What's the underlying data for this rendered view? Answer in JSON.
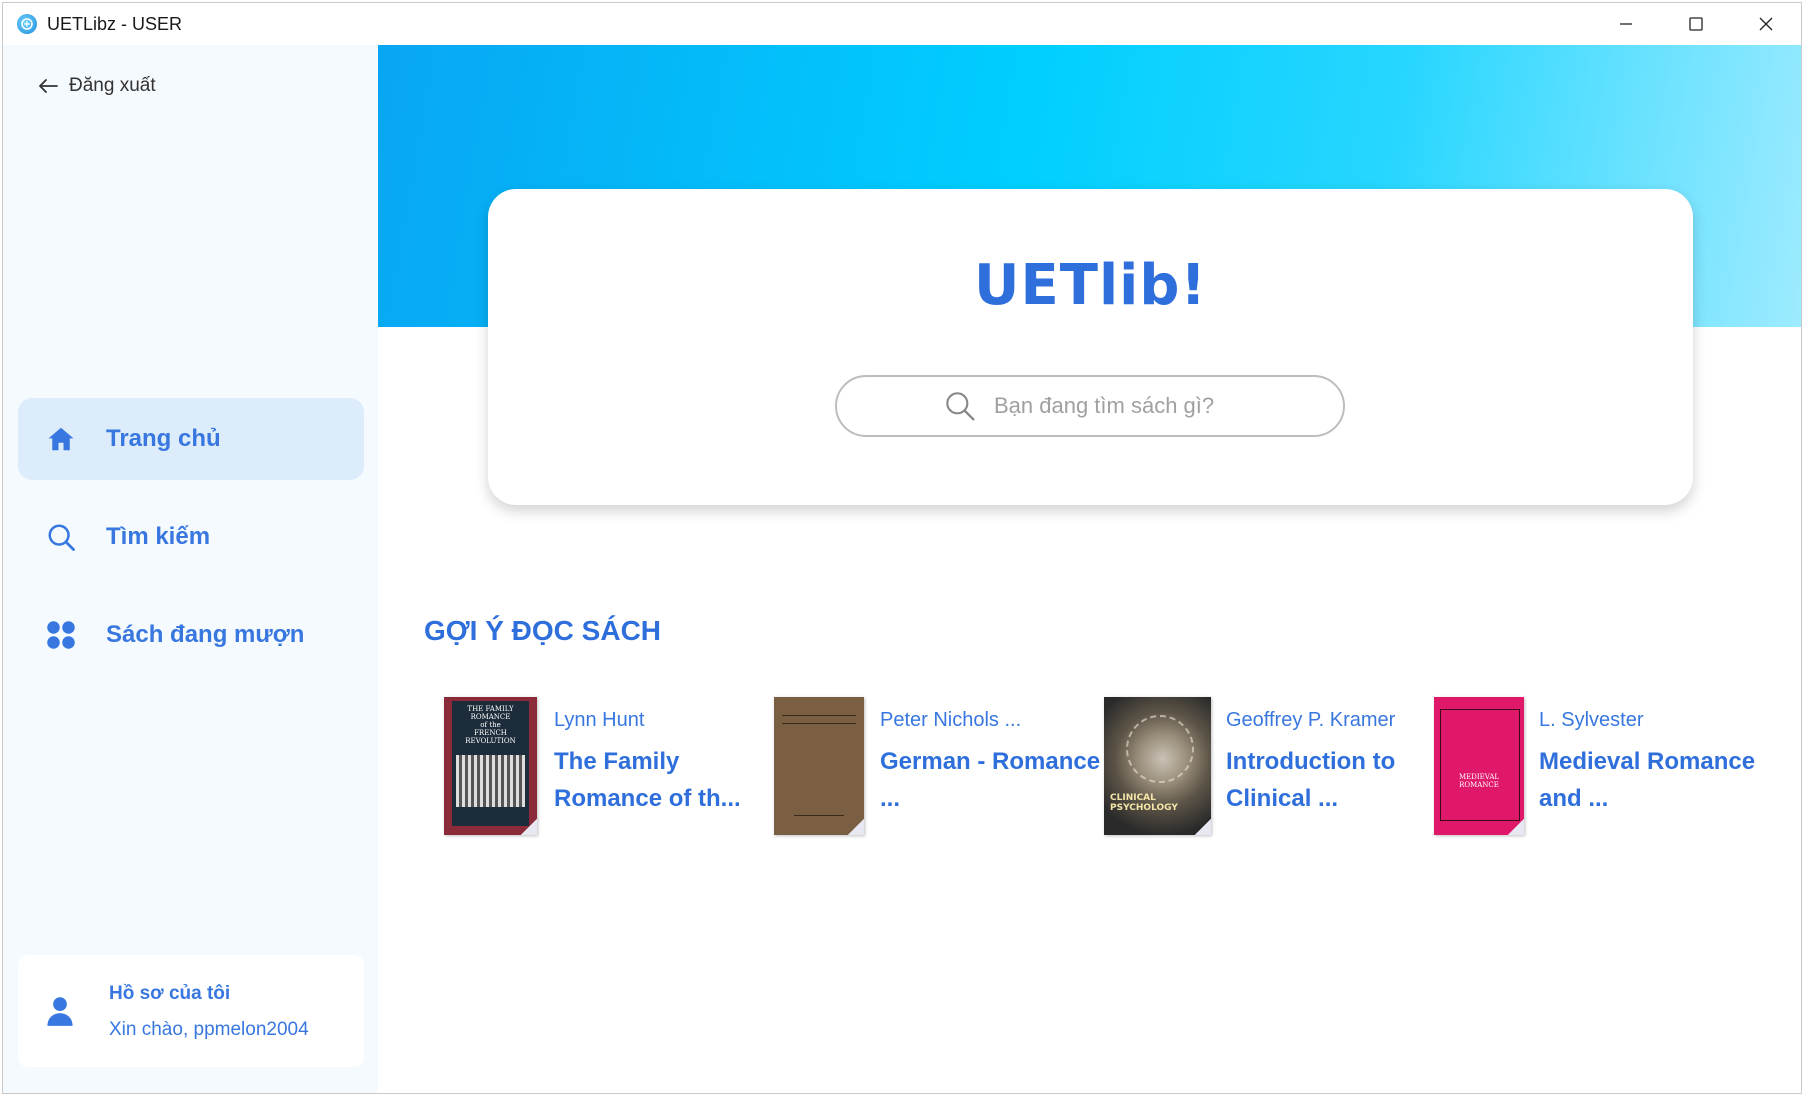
{
  "window": {
    "title": "UETLibz - USER",
    "icons": [
      "app-icon",
      "minimize-icon",
      "maximize-icon",
      "close-icon"
    ]
  },
  "sidebar": {
    "logout_label": "Đăng xuất",
    "nav": [
      {
        "label": "Trang chủ",
        "icon": "home-icon",
        "active": true
      },
      {
        "label": "Tìm kiếm",
        "icon": "search-icon",
        "active": false
      },
      {
        "label": "Sách đang mượn",
        "icon": "grid-icon",
        "active": false
      }
    ],
    "profile": {
      "title": "Hồ sơ của tôi",
      "greeting": "Xin chào, ppmelon2004"
    }
  },
  "main": {
    "brand": "UETlib!",
    "search_placeholder": "Bạn đang tìm sách gì?",
    "section_title": "GỢI Ý ĐỌC SÁCH",
    "books": [
      {
        "author": "Lynn Hunt",
        "title": "The Family Romance of th...",
        "cover_color": "#8b2b3a"
      },
      {
        "author": "Peter Nichols ...",
        "title": "German - Romance ...",
        "cover_color": "#7a5f43"
      },
      {
        "author": "Geoffrey P. Kramer",
        "title": "Introduction to Clinical ...",
        "cover_color": "#2a2a2a"
      },
      {
        "author": "L. Sylvester",
        "title": "Medieval Romance and ...",
        "cover_color": "#e0186a"
      }
    ]
  },
  "colors": {
    "accent": "#2f6fdb",
    "sidebar_bg": "#f5fafe",
    "active_nav_bg": "#dcecfb"
  }
}
